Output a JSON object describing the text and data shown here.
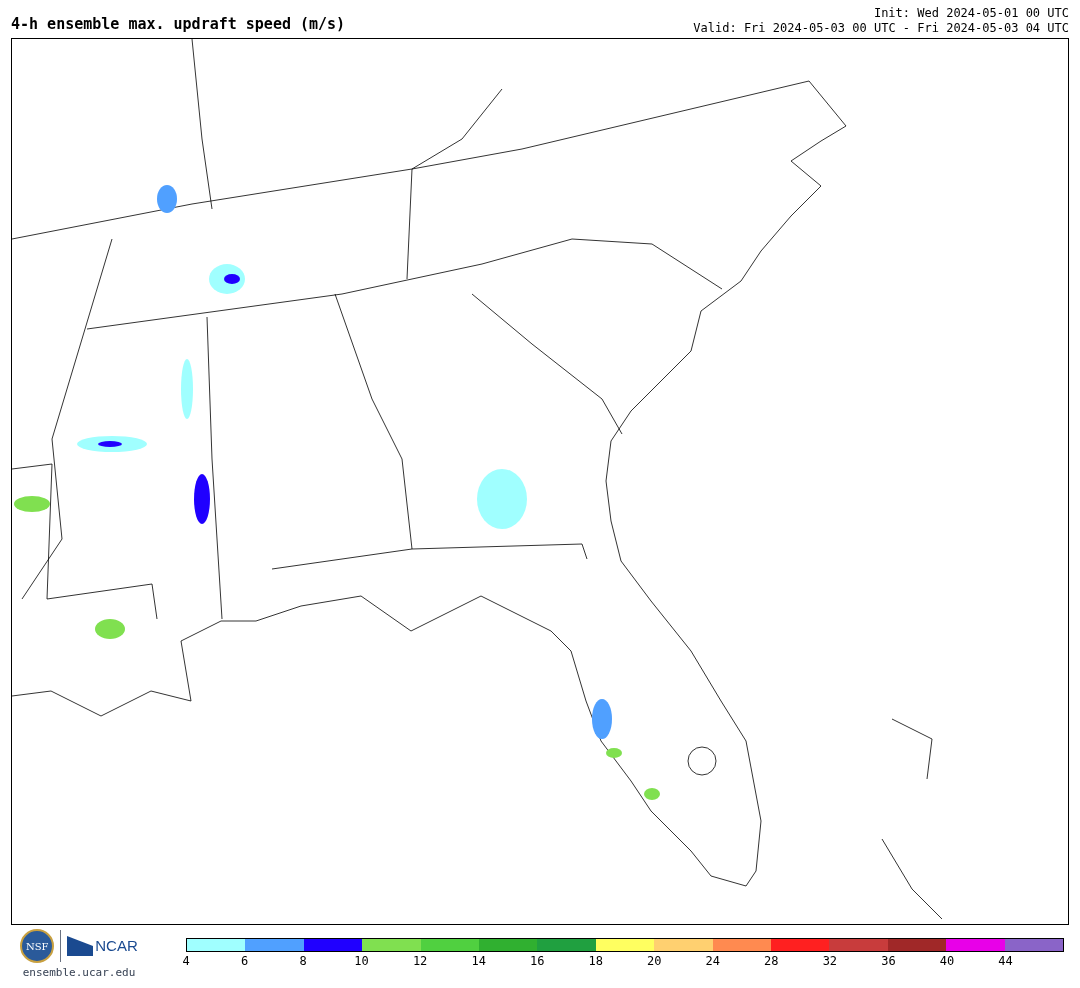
{
  "title": "4-h ensemble max. updraft speed (m/s)",
  "init": "Init: Wed 2024-05-01 00 UTC",
  "valid": "Valid: Fri 2024-05-03 00 UTC - Fri 2024-05-03 04 UTC",
  "logo": {
    "nsf": "NSF",
    "ncar": "NCAR",
    "url": "ensemble.ucar.edu"
  },
  "colorbar": {
    "segments": [
      {
        "color": "#a0ffff",
        "label": "4"
      },
      {
        "color": "#50a0ff",
        "label": "6"
      },
      {
        "color": "#2000ff",
        "label": "8"
      },
      {
        "color": "#80e050",
        "label": "10"
      },
      {
        "color": "#50d040",
        "label": "12"
      },
      {
        "color": "#30b030",
        "label": "14"
      },
      {
        "color": "#20a040",
        "label": "16"
      },
      {
        "color": "#ffff60",
        "label": "18"
      },
      {
        "color": "#ffd070",
        "label": "20"
      },
      {
        "color": "#ff8a50",
        "label": "24"
      },
      {
        "color": "#ff2020",
        "label": "28"
      },
      {
        "color": "#c83c3c",
        "label": "32"
      },
      {
        "color": "#a02828",
        "label": "36"
      },
      {
        "color": "#e800e8",
        "label": "40"
      },
      {
        "color": "#8a64c8",
        "label": "44"
      }
    ]
  }
}
